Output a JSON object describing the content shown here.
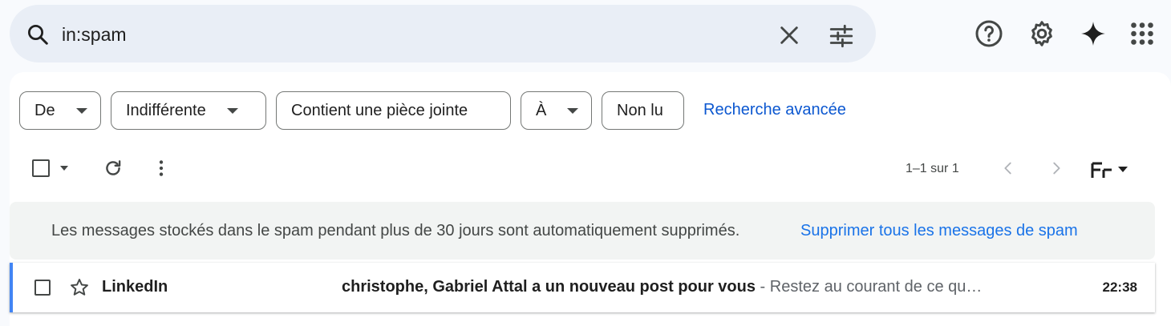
{
  "search": {
    "query": "in:spam"
  },
  "filters": {
    "from": "De",
    "date": "Indifférente",
    "attachment": "Contient une pièce jointe",
    "to": "À",
    "unread": "Non lu",
    "advanced": "Recherche avancée"
  },
  "toolbar": {
    "count": "1–1 sur 1"
  },
  "banner": {
    "message": "Les messages stockés dans le spam pendant plus de 30 jours sont automatiquement supprimés.",
    "action": "Supprimer tous les messages de spam"
  },
  "emails": [
    {
      "sender": "LinkedIn",
      "subject": "christophe, Gabriel Attal a un nouveau post pour vous",
      "separator": " - ",
      "snippet": "Restez au courant de ce qu…",
      "time": "22:38"
    }
  ],
  "icons": {
    "search": "search-icon",
    "clear": "close-icon",
    "tune": "tune-icon",
    "help": "help-icon",
    "settings": "gear-icon",
    "gemini": "sparkle-icon",
    "apps": "apps-grid-icon",
    "refresh": "refresh-icon",
    "more": "more-vert-icon",
    "prev": "chevron-left-icon",
    "next": "chevron-right-icon",
    "input_tools": "input-tools-icon",
    "star": "star-icon"
  },
  "colors": {
    "accent": "#0b57d0",
    "link": "#1a73e8",
    "search_bg": "#e9eef6",
    "unread_bar": "#4285f4"
  }
}
